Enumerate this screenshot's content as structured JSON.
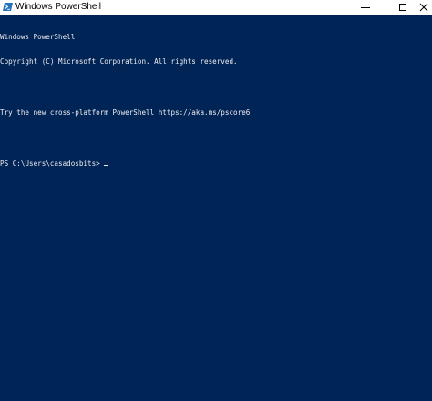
{
  "window": {
    "title": "Windows PowerShell",
    "icon": "powershell-icon",
    "background_color": "#012456",
    "text_color": "#eeedf0"
  },
  "controls": {
    "minimize_icon": "minimize-icon",
    "maximize_icon": "maximize-icon",
    "close_icon": "close-icon"
  },
  "console": {
    "lines": [
      "Windows PowerShell",
      "Copyright (C) Microsoft Corporation. All rights reserved.",
      "",
      "Try the new cross-platform PowerShell https://aka.ms/pscore6",
      ""
    ],
    "prompt": "PS C:\\Users\\casadosbits> "
  }
}
